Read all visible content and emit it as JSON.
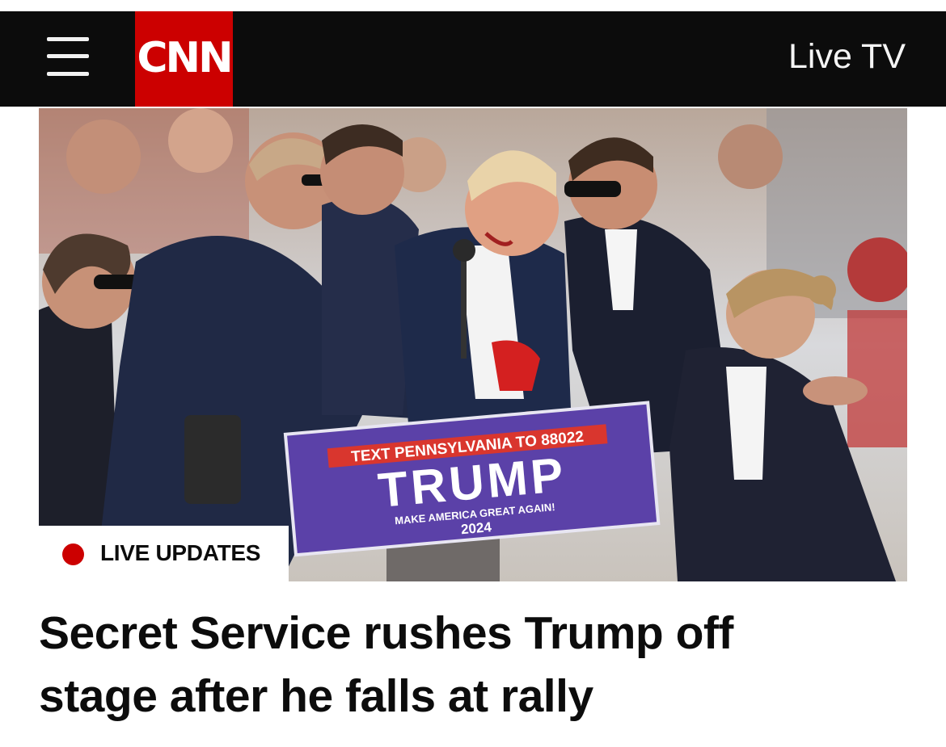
{
  "header": {
    "menu_icon": "hamburger-menu-icon",
    "logo_text": "CNN",
    "live_tv_label": "Live TV",
    "colors": {
      "bar": "#0c0c0c",
      "brand_red": "#cc0000"
    }
  },
  "hero": {
    "sign": {
      "top_line": "TEXT PENNSYLVANIA TO 88022",
      "title": "TRUMP",
      "slogan": "MAKE AMERICA GREAT AGAIN!",
      "year": "2024"
    }
  },
  "badge": {
    "label": "LIVE UPDATES",
    "dot_color": "#cc0000"
  },
  "article": {
    "headline": "Secret Service rushes Trump off stage after he falls at rally"
  }
}
